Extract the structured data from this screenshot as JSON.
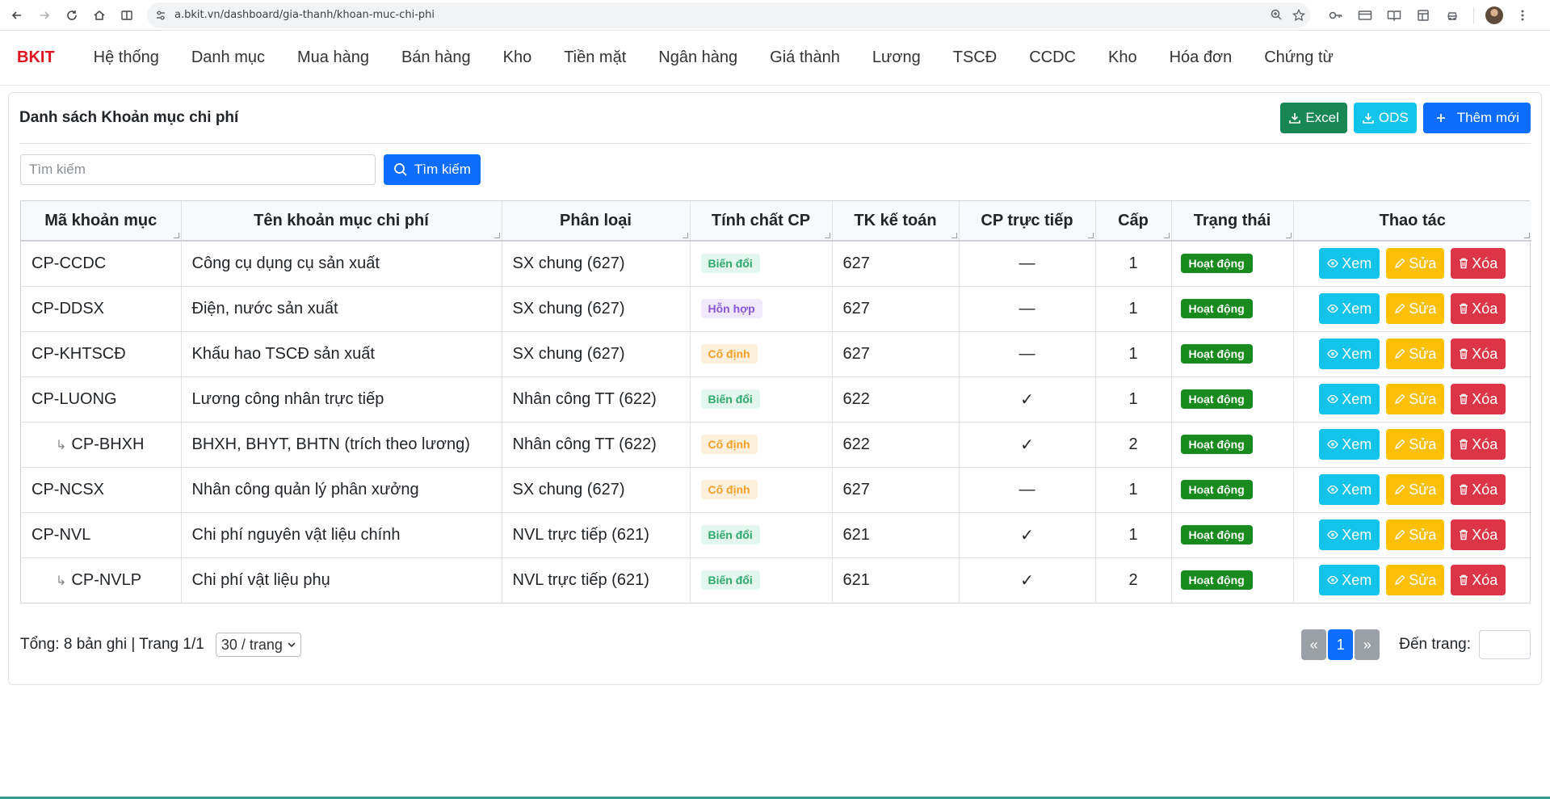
{
  "browser": {
    "url": "a.bkit.vn/dashboard/gia-thanh/khoan-muc-chi-phi"
  },
  "topnav": {
    "brand": "BKIT",
    "items": [
      "Hệ thống",
      "Danh mục",
      "Mua hàng",
      "Bán hàng",
      "Kho",
      "Tiền mặt",
      "Ngân hàng",
      "Giá thành",
      "Lương",
      "TSCĐ",
      "CCDC",
      "Kho",
      "Hóa đơn",
      "Chứng từ"
    ]
  },
  "page": {
    "title": "Danh sách Khoản mục chi phí",
    "excel_label": "Excel",
    "ods_label": "ODS",
    "add_label": "Thêm mới",
    "search_placeholder": "Tìm kiếm",
    "search_button": "Tìm kiếm"
  },
  "table": {
    "headers": [
      "Mã khoản mục",
      "Tên khoản mục chi phí",
      "Phân loại",
      "Tính chất CP",
      "TK kế toán",
      "CP trực tiếp",
      "Cấp",
      "Trạng thái",
      "Thao tác"
    ],
    "rows": [
      {
        "code": "CP-CCDC",
        "name": "Công cụ dụng cụ sản xuất",
        "type": "SX chung (627)",
        "nature": "Biến đổi",
        "account": "627",
        "direct": "—",
        "level": "1",
        "status": "Hoạt động",
        "child": false
      },
      {
        "code": "CP-DDSX",
        "name": "Điện, nước sản xuất",
        "type": "SX chung (627)",
        "nature": "Hỗn hợp",
        "account": "627",
        "direct": "—",
        "level": "1",
        "status": "Hoạt động",
        "child": false
      },
      {
        "code": "CP-KHTSCĐ",
        "name": "Khấu hao TSCĐ sản xuất",
        "type": "SX chung (627)",
        "nature": "Cố định",
        "account": "627",
        "direct": "—",
        "level": "1",
        "status": "Hoạt động",
        "child": false
      },
      {
        "code": "CP-LUONG",
        "name": "Lương công nhân trực tiếp",
        "type": "Nhân công TT (622)",
        "nature": "Biến đổi",
        "account": "622",
        "direct": "✓",
        "level": "1",
        "status": "Hoạt động",
        "child": false
      },
      {
        "code": "CP-BHXH",
        "name": "BHXH, BHYT, BHTN (trích theo lương)",
        "type": "Nhân công TT (622)",
        "nature": "Cố định",
        "account": "622",
        "direct": "✓",
        "level": "2",
        "status": "Hoạt động",
        "child": true
      },
      {
        "code": "CP-NCSX",
        "name": "Nhân công quản lý phân xưởng",
        "type": "SX chung (627)",
        "nature": "Cố định",
        "account": "627",
        "direct": "—",
        "level": "1",
        "status": "Hoạt động",
        "child": false
      },
      {
        "code": "CP-NVL",
        "name": "Chi phí nguyên vật liệu chính",
        "type": "NVL trực tiếp (621)",
        "nature": "Biến đổi",
        "account": "621",
        "direct": "✓",
        "level": "1",
        "status": "Hoạt động",
        "child": false
      },
      {
        "code": "CP-NVLP",
        "name": "Chi phí vật liệu phụ",
        "type": "NVL trực tiếp (621)",
        "nature": "Biến đổi",
        "account": "621",
        "direct": "✓",
        "level": "2",
        "status": "Hoạt động",
        "child": true
      }
    ],
    "actions": {
      "view": "Xem",
      "edit": "Sửa",
      "delete": "Xóa"
    },
    "child_marker": "↳"
  },
  "footer": {
    "summary": "Tổng: 8 bản ghi | Trang 1/1",
    "page_size": "30 / trang",
    "prev": "«",
    "current_page": "1",
    "next": "»",
    "goto_label": "Đến trang:"
  },
  "colors": {
    "brand": "#e0141e",
    "primary": "#0d6efd",
    "excel": "#198754",
    "info": "#14c3e9",
    "warning": "#fcc107",
    "danger": "#dc3545",
    "status_active": "#198a1e"
  }
}
